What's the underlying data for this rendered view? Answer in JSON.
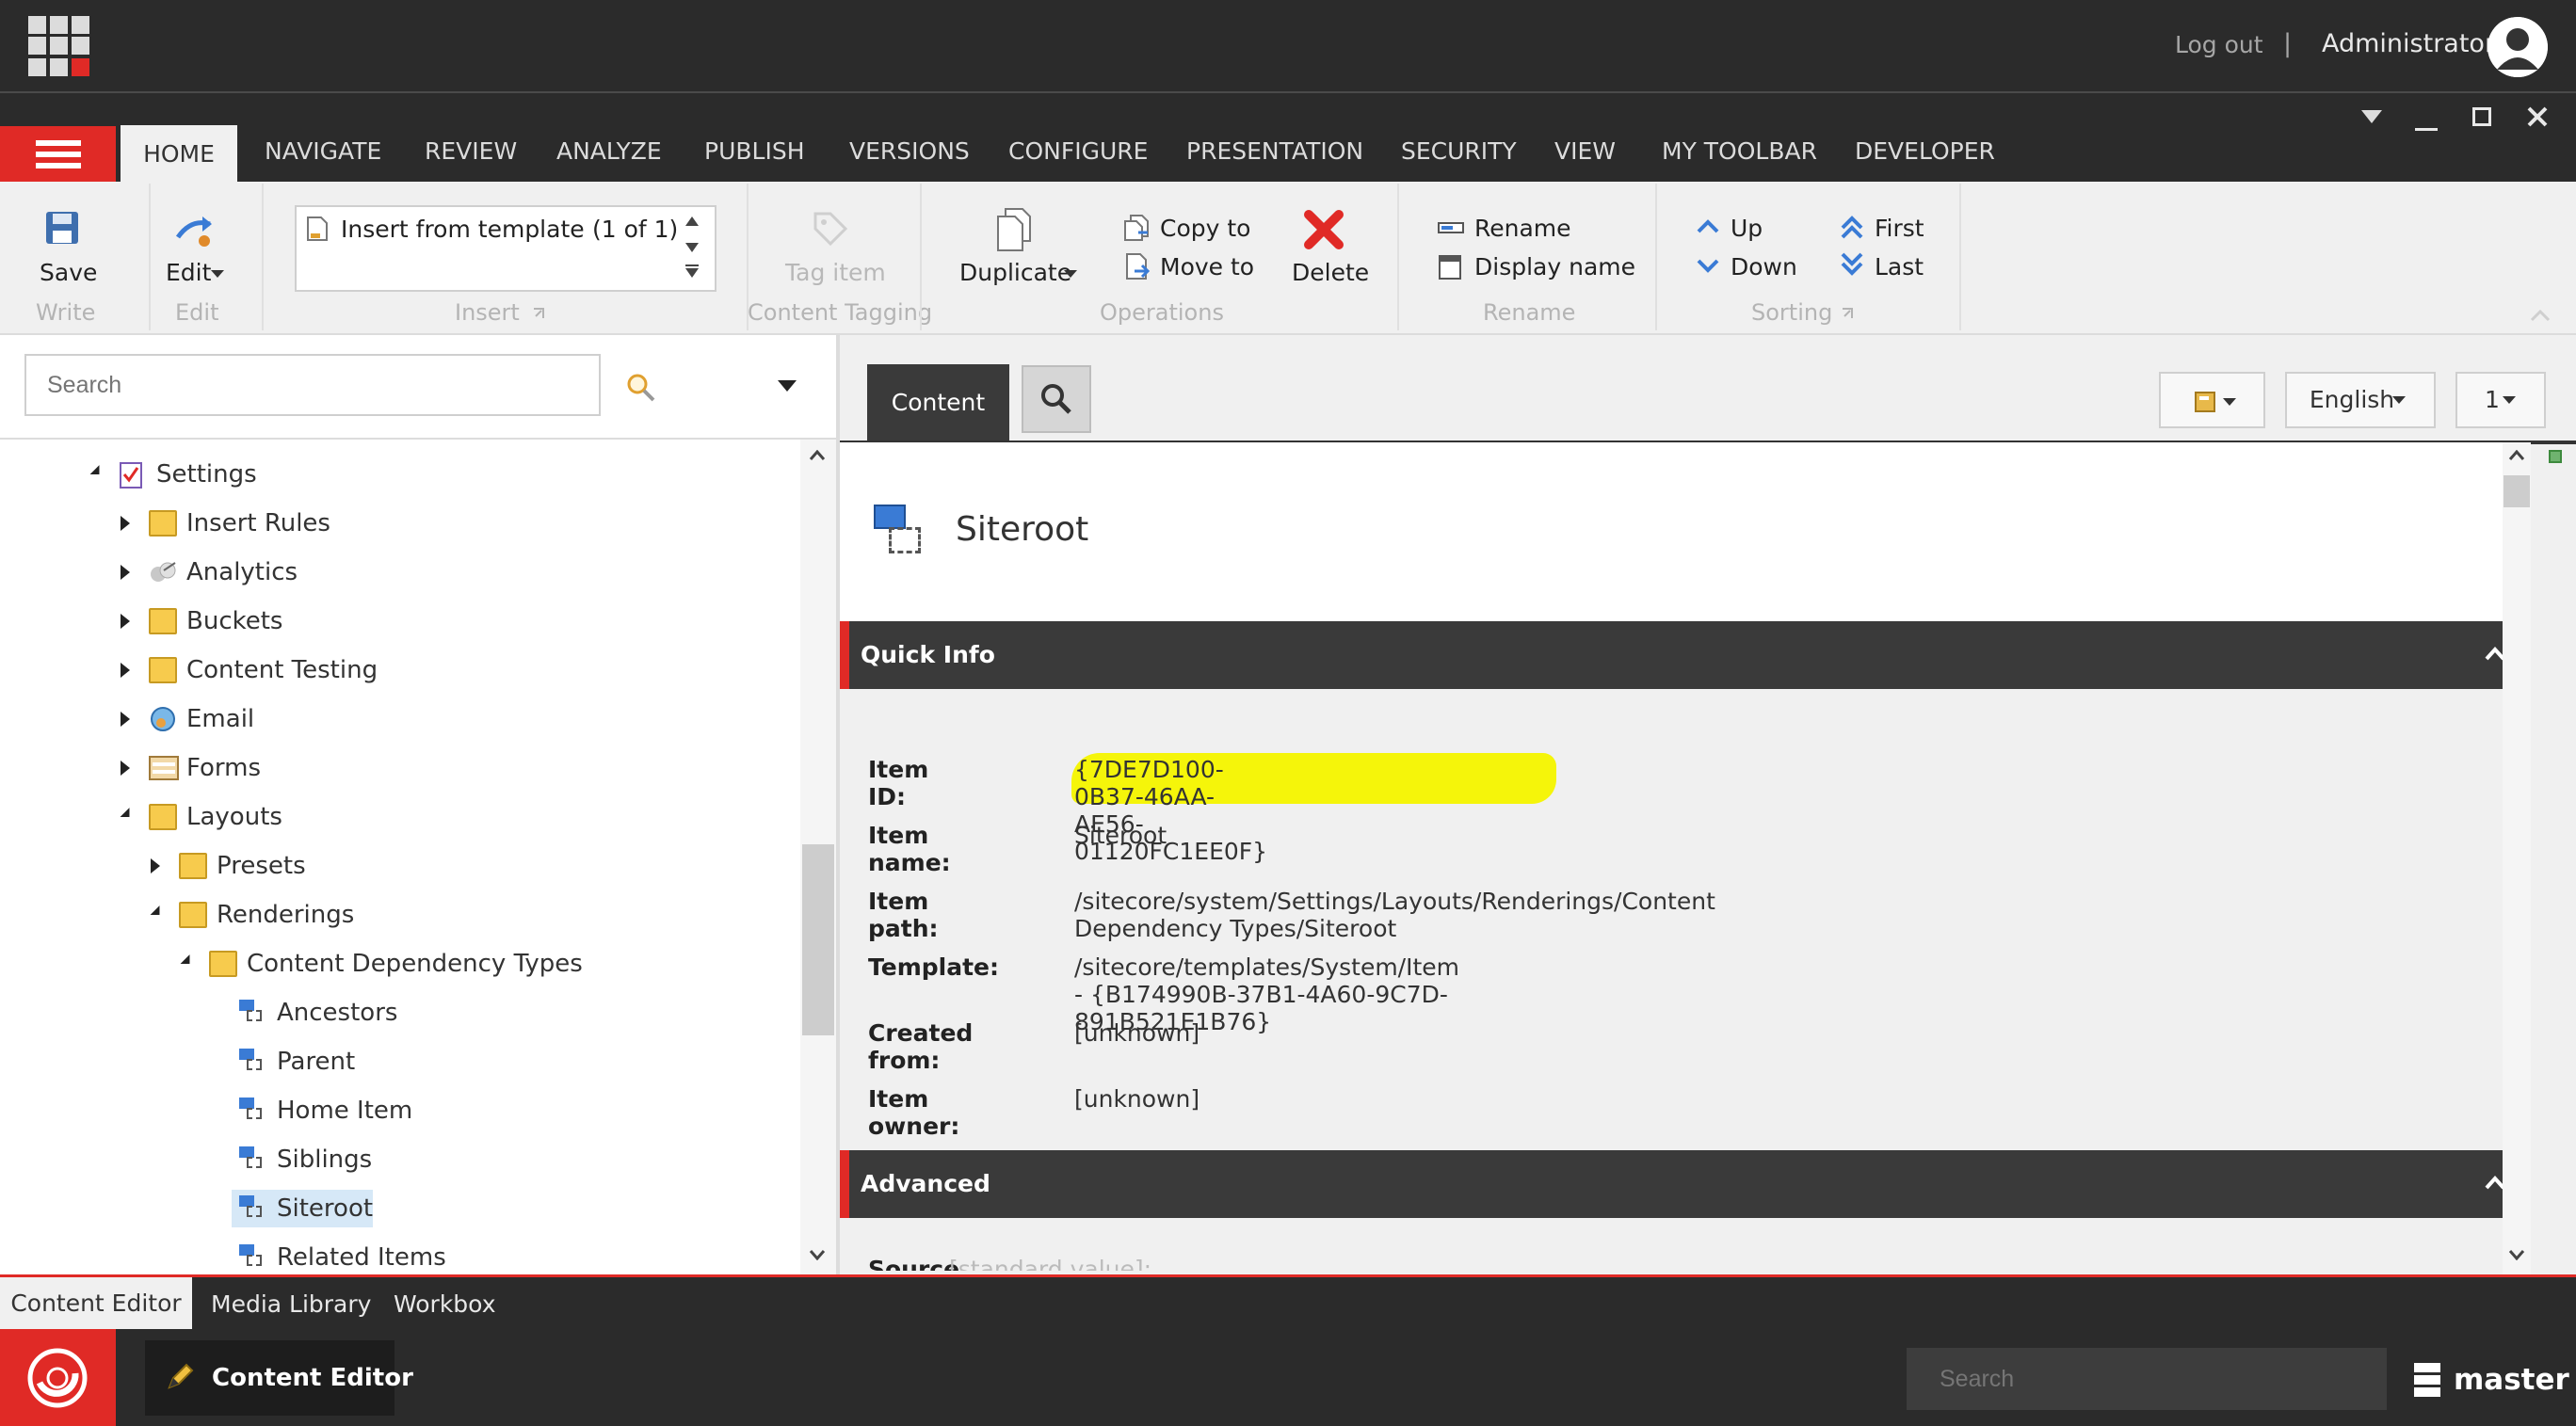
{
  "topbar": {
    "logout": "Log out",
    "separator": "|",
    "user": "Administrator"
  },
  "ribbon": {
    "tabs": [
      "HOME",
      "NAVIGATE",
      "REVIEW",
      "ANALYZE",
      "PUBLISH",
      "VERSIONS",
      "CONFIGURE",
      "PRESENTATION",
      "SECURITY",
      "VIEW",
      "MY TOOLBAR",
      "DEVELOPER"
    ],
    "save": "Save",
    "edit": "Edit",
    "insert_template": "Insert from template",
    "insert_count": "(1 of 1)",
    "tag_item": "Tag item",
    "duplicate": "Duplicate",
    "copy_to": "Copy to",
    "move_to": "Move to",
    "delete": "Delete",
    "rename": "Rename",
    "display_name": "Display name",
    "up": "Up",
    "down": "Down",
    "first": "First",
    "last": "Last",
    "groups": {
      "write": "Write",
      "edit": "Edit",
      "insert": "Insert",
      "content_tagging": "Content Tagging",
      "operations": "Operations",
      "rename": "Rename",
      "sorting": "Sorting"
    }
  },
  "tree": {
    "search_placeholder": "Search",
    "items": [
      {
        "label": "Settings",
        "level": 0,
        "state": "open",
        "icon": "settings-icon"
      },
      {
        "label": "Insert Rules",
        "level": 1,
        "state": "closed",
        "icon": "folder-icon"
      },
      {
        "label": "Analytics",
        "level": 1,
        "state": "closed",
        "icon": "analytics-icon"
      },
      {
        "label": "Buckets",
        "level": 1,
        "state": "closed",
        "icon": "folder-icon"
      },
      {
        "label": "Content Testing",
        "level": 1,
        "state": "closed",
        "icon": "folder-icon"
      },
      {
        "label": "Email",
        "level": 1,
        "state": "closed",
        "icon": "email-icon"
      },
      {
        "label": "Forms",
        "level": 1,
        "state": "closed",
        "icon": "forms-icon"
      },
      {
        "label": "Layouts",
        "level": 1,
        "state": "open",
        "icon": "folder-icon"
      },
      {
        "label": "Presets",
        "level": 2,
        "state": "closed",
        "icon": "folder-icon"
      },
      {
        "label": "Renderings",
        "level": 2,
        "state": "open",
        "icon": "folder-icon"
      },
      {
        "label": "Content Dependency Types",
        "level": 3,
        "state": "open",
        "icon": "folder-icon"
      },
      {
        "label": "Ancestors",
        "level": 4,
        "state": "leaf",
        "icon": "rendering-icon"
      },
      {
        "label": "Parent",
        "level": 4,
        "state": "leaf",
        "icon": "rendering-icon"
      },
      {
        "label": "Home Item",
        "level": 4,
        "state": "leaf",
        "icon": "rendering-icon"
      },
      {
        "label": "Siblings",
        "level": 4,
        "state": "leaf",
        "icon": "rendering-icon"
      },
      {
        "label": "Siteroot",
        "level": 4,
        "state": "selected",
        "icon": "rendering-icon"
      },
      {
        "label": "Related Items",
        "level": 4,
        "state": "leaf",
        "icon": "rendering-icon"
      }
    ]
  },
  "content": {
    "tab_content": "Content",
    "language": "English",
    "version": "1",
    "title": "Siteroot",
    "quick_info_title": "Quick Info",
    "advanced_title": "Advanced",
    "fields": [
      {
        "label": "Item ID:",
        "value": "{7DE7D100-0B37-46AA-AE56-01120FC1EE0F}"
      },
      {
        "label": "Item name:",
        "value": "Siteroot"
      },
      {
        "label": "Item path:",
        "value": "/sitecore/system/Settings/Layouts/Renderings/Content Dependency Types/Siteroot"
      },
      {
        "label": "Template:",
        "value": "/sitecore/templates/System/Item - {B174990B-37B1-4A60-9C7D-891B521E1B76}"
      },
      {
        "label": "Created from:",
        "value": "[unknown]"
      },
      {
        "label": "Item owner:",
        "value": "[unknown]"
      }
    ],
    "advanced_first_label": "Source",
    "advanced_first_hint": "[standard value]:"
  },
  "bottom": {
    "tabs": [
      "Content Editor",
      "Media Library",
      "Workbox"
    ],
    "app_button": "Content Editor",
    "search_placeholder": "Search",
    "database": "master"
  },
  "colors": {
    "accent": "#e02a26",
    "dark": "#2b2b2b",
    "highlight": "#f5f50a"
  }
}
